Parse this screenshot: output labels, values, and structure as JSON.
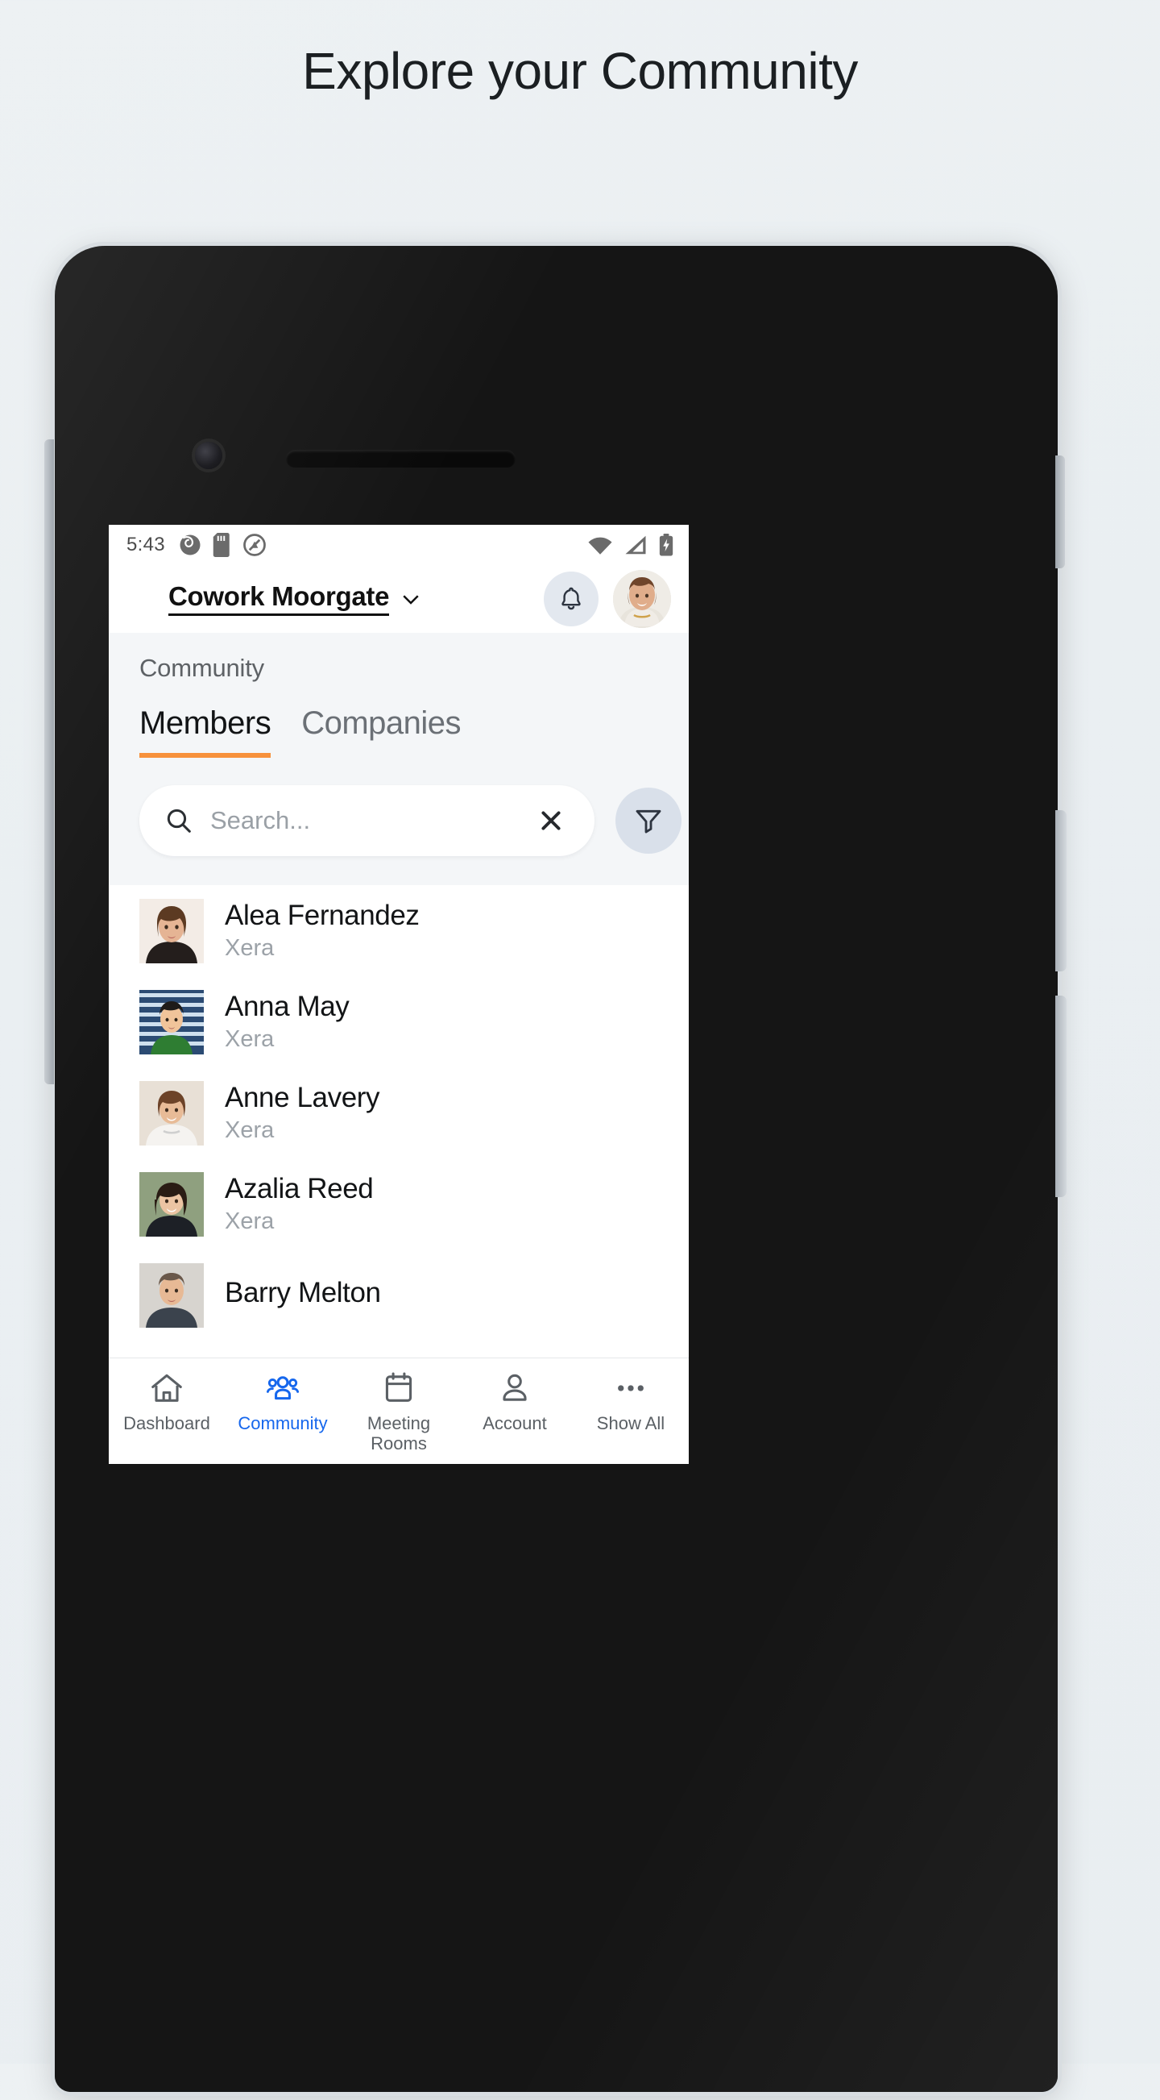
{
  "page": {
    "headline": "Explore your Community"
  },
  "statusbar": {
    "time": "5:43",
    "left_icons": [
      "camera-aperture-icon",
      "sd-card-icon",
      "circle-slash-icon"
    ],
    "right_icons": [
      "wifi-icon",
      "cellular-signal-icon",
      "battery-charging-icon"
    ]
  },
  "appbar": {
    "venue_name": "Cowork Moorgate",
    "venue_chevron": "chevron-down-icon",
    "bell_icon": "bell-icon",
    "avatar": "user-avatar"
  },
  "section": {
    "title": "Community",
    "tabs": [
      {
        "label": "Members",
        "active": true
      },
      {
        "label": "Companies",
        "active": false
      }
    ]
  },
  "search": {
    "placeholder": "Search...",
    "value": "",
    "search_icon": "search-icon",
    "clear_icon": "close-icon",
    "filter_icon": "filter-funnel-icon"
  },
  "members": [
    {
      "name": "Alea Fernandez",
      "company": "Xera"
    },
    {
      "name": "Anna May",
      "company": "Xera"
    },
    {
      "name": "Anne Lavery",
      "company": "Xera"
    },
    {
      "name": "Azalia Reed",
      "company": "Xera"
    },
    {
      "name": "Barry Melton",
      "company": ""
    }
  ],
  "bottomnav": {
    "items": [
      {
        "label": "Dashboard",
        "icon": "home-icon",
        "active": false
      },
      {
        "label": "Community",
        "icon": "people-group-icon",
        "active": true
      },
      {
        "label": "Meeting Rooms",
        "icon": "calendar-icon",
        "active": false
      },
      {
        "label": "Account",
        "icon": "person-icon",
        "active": false
      },
      {
        "label": "Show All",
        "icon": "ellipsis-icon",
        "active": false
      }
    ]
  },
  "colors": {
    "accent_orange": "#f7913c",
    "accent_blue": "#1667ed",
    "page_bg": "#edf1f3",
    "section_bg": "#f4f6f8",
    "chip_bg": "#d9e0ea"
  }
}
